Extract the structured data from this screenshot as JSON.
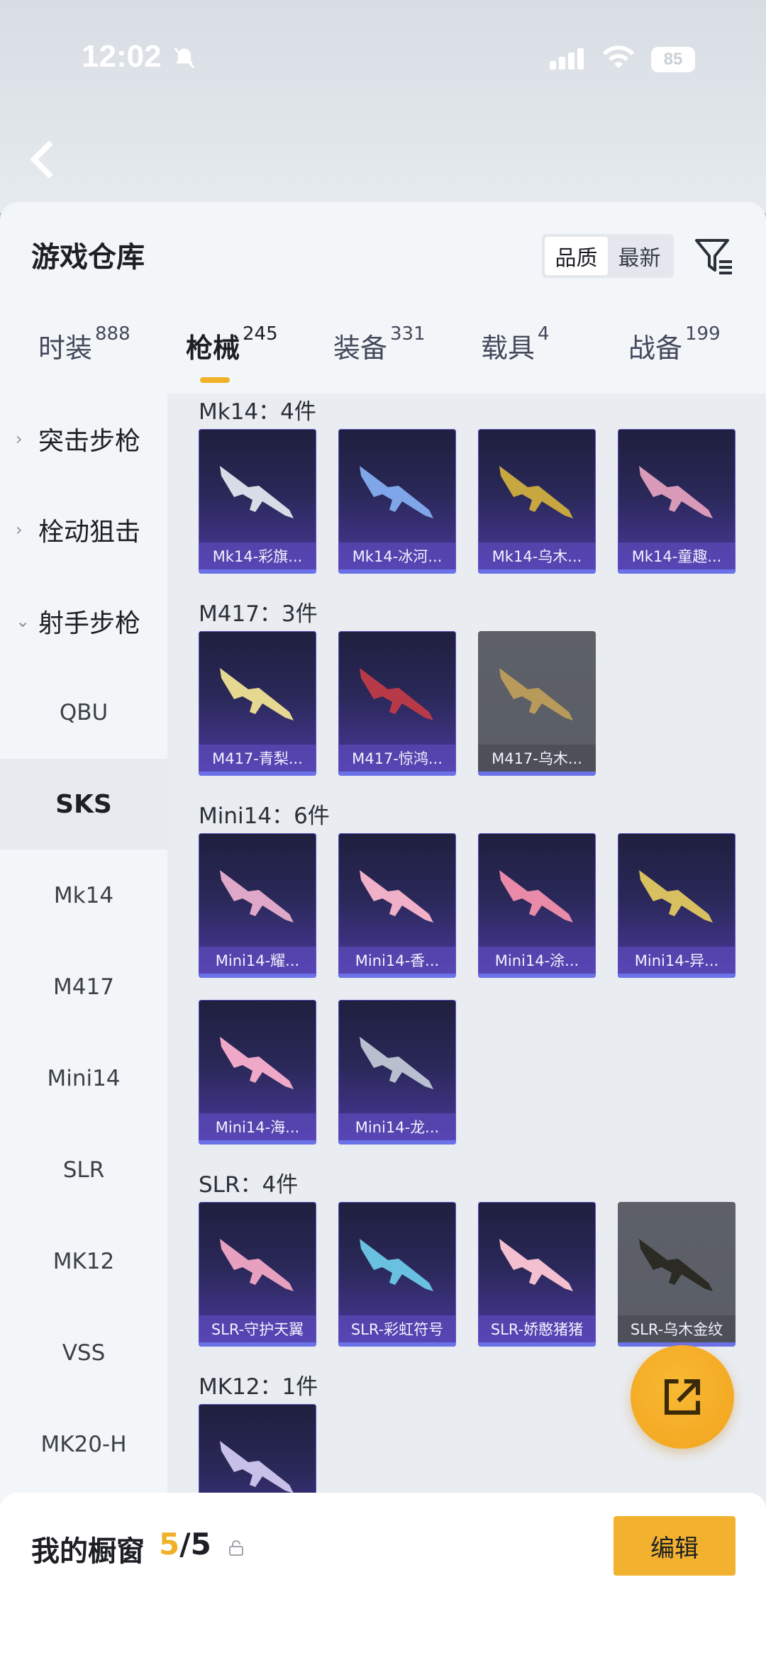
{
  "status_bar": {
    "time": "12:02",
    "battery": "85"
  },
  "header": {
    "title": "游戏仓库",
    "sort_options": [
      "品质",
      "最新"
    ],
    "sort_selected": "品质"
  },
  "tabs": [
    {
      "label": "时装",
      "count": "888"
    },
    {
      "label": "枪械",
      "count": "245",
      "active": true
    },
    {
      "label": "装备",
      "count": "331"
    },
    {
      "label": "载具",
      "count": "4"
    },
    {
      "label": "战备",
      "count": "199"
    }
  ],
  "sidebar": {
    "categories": [
      "突击步枪",
      "栓动狙击",
      "射手步枪"
    ],
    "items": [
      "QBU",
      "SKS",
      "Mk14",
      "M417",
      "Mini14",
      "SLR",
      "MK12",
      "VSS",
      "MK20-H"
    ],
    "active_item": "SKS"
  },
  "groups": [
    {
      "title": "Mk14：4件",
      "items": [
        "Mk14-彩旗...",
        "Mk14-冰河...",
        "Mk14-乌木...",
        "Mk14-童趣..."
      ]
    },
    {
      "title": "M417：3件",
      "items": [
        "M417-青梨...",
        "M417-惊鸿...",
        "M417-乌木..."
      ]
    },
    {
      "title": "Mini14：6件",
      "items": [
        "Mini14-耀...",
        "Mini14-香...",
        "Mini14-涂...",
        "Mini14-异...",
        "Mini14-海...",
        "Mini14-龙..."
      ]
    },
    {
      "title": "SLR：4件",
      "items": [
        "SLR-守护天翼",
        "SLR-彩虹符号",
        "SLR-娇憨猪猪",
        "SLR-乌木金纹"
      ]
    },
    {
      "title": "MK12：1件",
      "items": [
        ""
      ]
    }
  ],
  "bottom_bar": {
    "title": "我的橱窗",
    "current": "5",
    "total": "/5",
    "edit_label": "编辑"
  },
  "colors": {
    "accent": "#f0b128",
    "card_purple": "#4a3aa0",
    "card_gray": "#5d6068"
  }
}
